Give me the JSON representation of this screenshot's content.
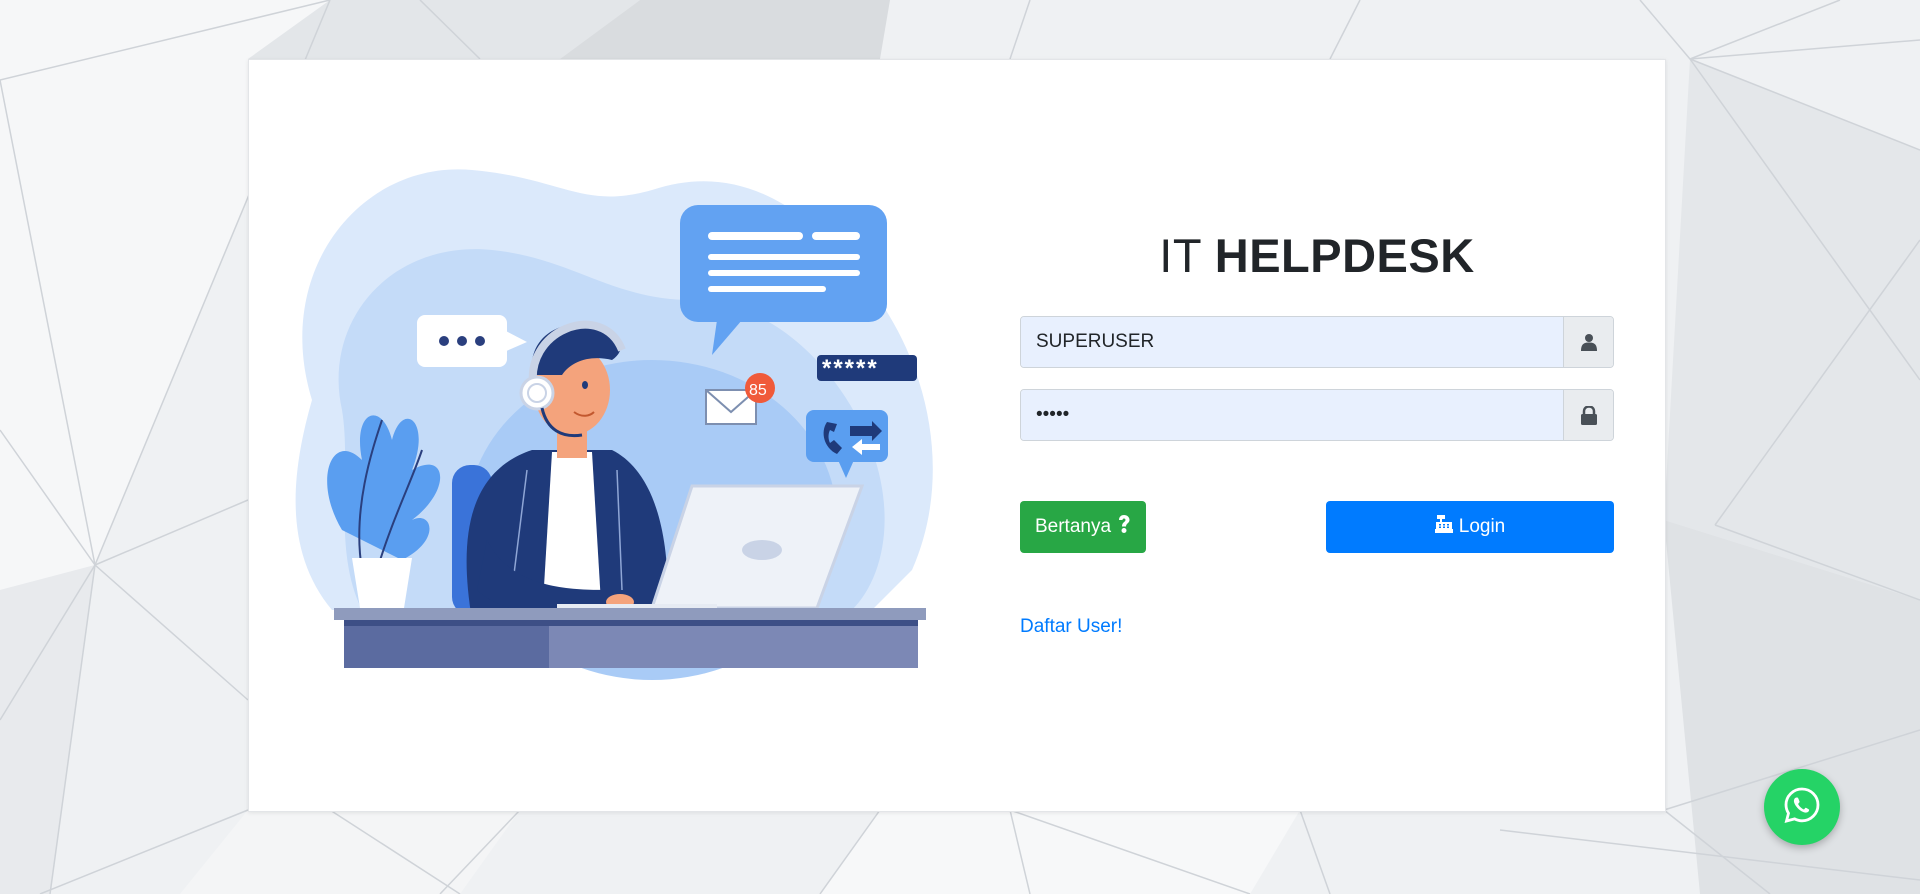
{
  "app": {
    "title_light": "IT",
    "title_bold": "HELPDESK"
  },
  "form": {
    "username_value": "SUPERUSER",
    "password_value": "•••••",
    "username_icon": "user-icon",
    "password_icon": "lock-icon"
  },
  "buttons": {
    "ask_label": "Bertanya",
    "ask_icon": "question-icon",
    "login_label": "Login",
    "login_icon": "cash-register-icon"
  },
  "links": {
    "register_label": "Daftar User!"
  },
  "illustration": {
    "notification_count": "85",
    "password_mask": "*****"
  },
  "floating": {
    "whatsapp_icon": "whatsapp-icon"
  },
  "colors": {
    "primary": "#007bff",
    "success": "#28a745",
    "whatsapp": "#25d366",
    "input_bg": "#e8f0fe"
  }
}
